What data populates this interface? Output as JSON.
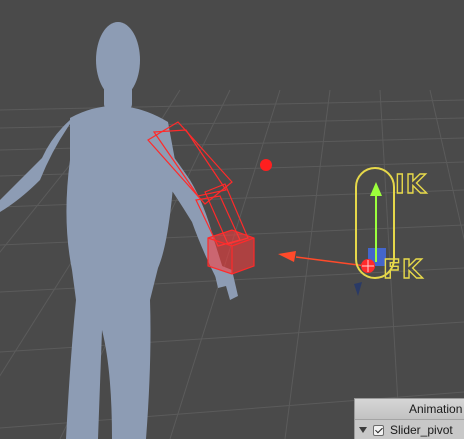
{
  "scene": {
    "colors": {
      "background": "#4a4a4a",
      "grid": "#5b5b5b",
      "body": "#8d9cb4",
      "bone_gizmo": "#ff2a2a",
      "ik_fk_gizmo": "#e6d84a",
      "slider_handle": "#9cff3c",
      "slider_base": "#4466cc"
    },
    "ik_label": "IK",
    "fk_label": "FK"
  },
  "animation_panel": {
    "title": "Animation",
    "row": {
      "label": "Slider_pivot",
      "checked": true
    }
  }
}
